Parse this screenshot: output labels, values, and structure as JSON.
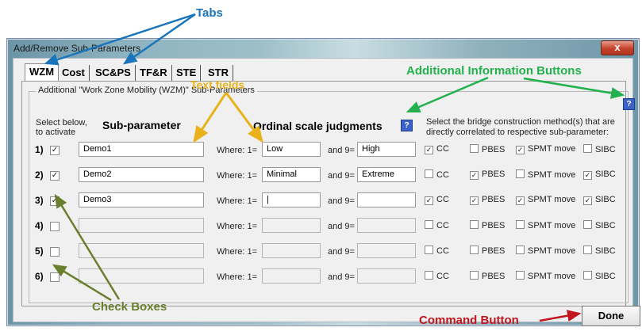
{
  "annotations": {
    "tabs": "Tabs",
    "additional_info": "Additional Information Buttons",
    "text_fields": "Text fields",
    "check_boxes": "Check Boxes",
    "command_button": "Command Button"
  },
  "window": {
    "title": "Add/Remove Sub-Parameters",
    "close_glyph": "x"
  },
  "tabs": [
    "WZM",
    "Cost",
    "SC&PS",
    "TF&R",
    "STE",
    "STR"
  ],
  "group_label": "Additional \"Work Zone Mobility (WZM)\" Sub-Parameters",
  "headers": {
    "select_below": "Select below,",
    "to_activate": "to activate",
    "sub_parameter": "Sub-parameter",
    "ordinal": "Ordinal scale judgments",
    "method_line1": "Select the bridge construction method(s) that are",
    "method_line2": "directly correlated to respective sub-parameter:",
    "help_glyph": "?"
  },
  "labels": {
    "where": "Where: 1=",
    "and9": "and 9="
  },
  "methods": [
    "CC",
    "PBES",
    "SPMT move",
    "SIBC"
  ],
  "rows": [
    {
      "num": "1)",
      "checked": true,
      "name": "Demo1",
      "low": "Low",
      "high": "High",
      "cc": true,
      "pbes": false,
      "spmt": true,
      "sibc": false
    },
    {
      "num": "2)",
      "checked": true,
      "name": "Demo2",
      "low": "Minimal",
      "high": "Extreme",
      "cc": false,
      "pbes": true,
      "spmt": false,
      "sibc": true
    },
    {
      "num": "3)",
      "checked": true,
      "name": "Demo3",
      "low": "|",
      "high": "",
      "cc": true,
      "pbes": true,
      "spmt": true,
      "sibc": true
    },
    {
      "num": "4)",
      "checked": false,
      "name": "",
      "low": "",
      "high": "",
      "cc": false,
      "pbes": false,
      "spmt": false,
      "sibc": false
    },
    {
      "num": "5)",
      "checked": false,
      "name": "",
      "low": "",
      "high": "",
      "cc": false,
      "pbes": false,
      "spmt": false,
      "sibc": false
    },
    {
      "num": "6)",
      "checked": false,
      "name": "",
      "low": "",
      "high": "",
      "cc": false,
      "pbes": false,
      "spmt": false,
      "sibc": false
    }
  ],
  "done_label": "Done",
  "colors": {
    "blue_ann": "#1a75bb",
    "green_ann": "#22b14c",
    "gold_ann": "#e8b21c",
    "olive_ann": "#6a7f2d",
    "red_ann": "#c0161e"
  }
}
